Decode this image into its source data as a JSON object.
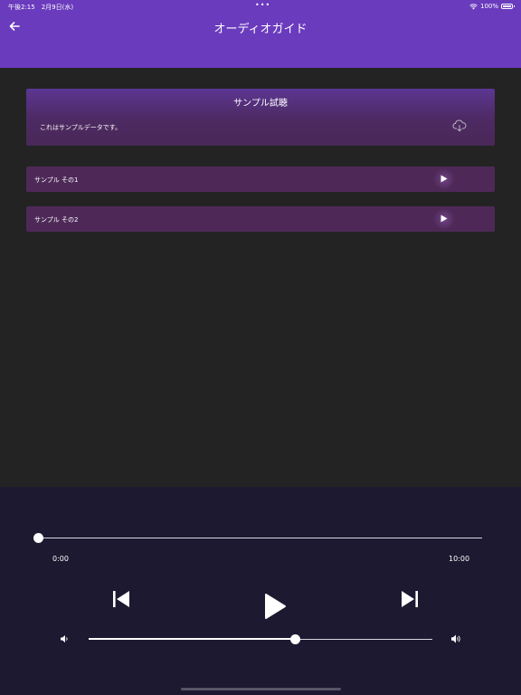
{
  "status_bar": {
    "time": "午後2:15　2月9日(水)",
    "dots": "•••",
    "battery": "100%"
  },
  "header": {
    "title": "オーディオガイド",
    "back_icon": "arrow-left-icon"
  },
  "sample": {
    "title": "サンプル試聴",
    "description": "これはサンプルデータです。",
    "icon": "cloud-download-icon"
  },
  "tracks": [
    {
      "label": "サンプル その1",
      "icon": "play-icon"
    },
    {
      "label": "サンプル その2",
      "icon": "play-icon"
    }
  ],
  "player": {
    "current_time": "0:00",
    "total_time": "10:00",
    "progress": 0.0,
    "volume": 0.6
  },
  "colors": {
    "header": "#6a3bbd",
    "background": "#232323",
    "card": "#4e2958",
    "player": "#1c1931"
  }
}
